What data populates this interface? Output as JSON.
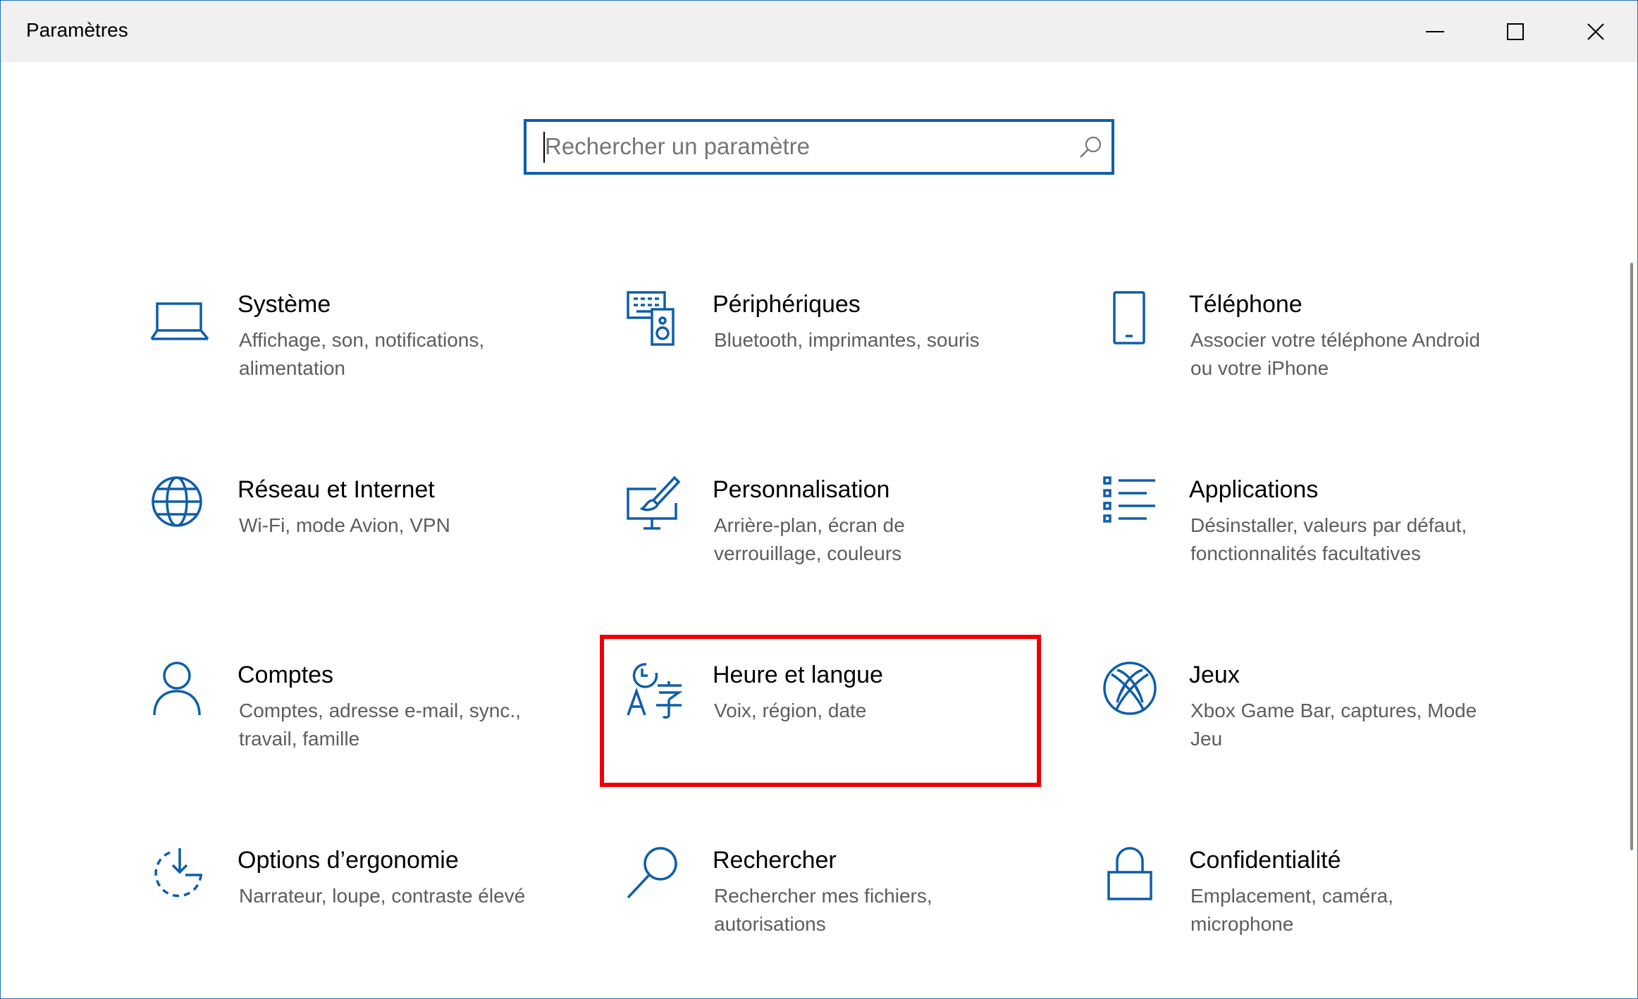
{
  "window": {
    "title": "Paramètres",
    "accent": "#0f5ea8",
    "highlight_color": "#ee0000"
  },
  "search": {
    "placeholder": "Rechercher un paramètre",
    "value": ""
  },
  "tiles": [
    {
      "title": "Système",
      "desc": "Affichage, son, notifications, alimentation",
      "icon": "laptop-icon"
    },
    {
      "title": "Périphériques",
      "desc": "Bluetooth, imprimantes, souris",
      "icon": "devices-icon"
    },
    {
      "title": "Téléphone",
      "desc": "Associer votre téléphone Android ou votre iPhone",
      "icon": "phone-icon"
    },
    {
      "title": "Réseau et Internet",
      "desc": "Wi-Fi, mode Avion, VPN",
      "icon": "globe-icon"
    },
    {
      "title": "Personnalisation",
      "desc": "Arrière-plan, écran de verrouillage, couleurs",
      "icon": "paint-brush-icon"
    },
    {
      "title": "Applications",
      "desc": "Désinstaller, valeurs par défaut, fonctionnalités facultatives",
      "icon": "app-list-icon"
    },
    {
      "title": "Comptes",
      "desc": "Comptes, adresse e-mail, sync., travail, famille",
      "icon": "person-icon"
    },
    {
      "title": "Heure et langue",
      "desc": "Voix, région, date",
      "icon": "time-language-icon"
    },
    {
      "title": "Jeux",
      "desc": "Xbox Game Bar, captures, Mode Jeu",
      "icon": "xbox-icon"
    },
    {
      "title": "Options d’ergonomie",
      "desc": "Narrateur, loupe, contraste élevé",
      "icon": "ease-of-access-icon"
    },
    {
      "title": "Rechercher",
      "desc": "Rechercher mes fichiers, autorisations",
      "icon": "magnifier-icon"
    },
    {
      "title": "Confidentialité",
      "desc": "Emplacement, caméra, microphone",
      "icon": "lock-icon"
    }
  ]
}
